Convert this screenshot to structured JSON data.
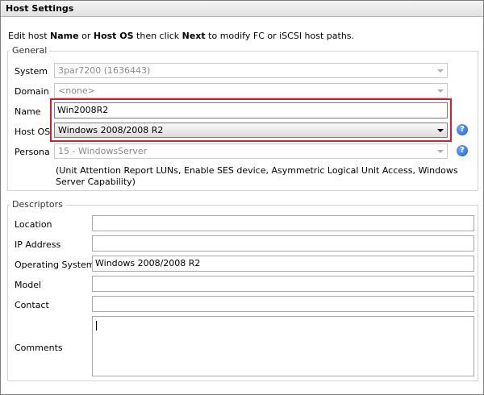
{
  "header": {
    "title": "Host Settings"
  },
  "intro": {
    "p1": "Edit host ",
    "b1": "Name",
    "p2": " or ",
    "b2": "Host OS",
    "p3": " then click ",
    "b3": "Next",
    "p4": " to modify FC or iSCSI host paths."
  },
  "general": {
    "title": "General",
    "system": {
      "label": "System",
      "value": "3par7200 (1636443)"
    },
    "domain": {
      "label": "Domain",
      "value": "<none>"
    },
    "name": {
      "label": "Name",
      "value": "Win2008R2"
    },
    "host_os": {
      "label": "Host OS",
      "value": "Windows 2008/2008 R2"
    },
    "persona": {
      "label": "Persona",
      "value": "15 - WindowsServer"
    },
    "persona_note": "(Unit Attention Report LUNs, Enable SES device, Asymmetric Logical Unit Access, Windows Server Capability)",
    "help_glyph": "?"
  },
  "descriptors": {
    "title": "Descriptors",
    "location": {
      "label": "Location",
      "value": ""
    },
    "ip_address": {
      "label": "IP Address",
      "value": ""
    },
    "operating_system": {
      "label": "Operating System",
      "value": "Windows 2008/2008 R2"
    },
    "model": {
      "label": "Model",
      "value": ""
    },
    "contact": {
      "label": "Contact",
      "value": ""
    },
    "comments": {
      "label": "Comments",
      "value": ""
    }
  },
  "colors": {
    "highlight": "#d2202f",
    "help_icon": "#1a5fd6",
    "header_bg": "#e8e8e8"
  },
  "icons": {
    "help": "help-icon",
    "dropdown": "chevron-down-icon"
  }
}
